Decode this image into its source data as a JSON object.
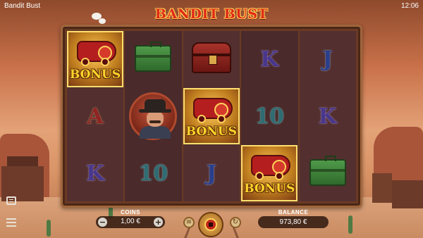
{
  "status_bar": {
    "app_title": "Bandit Bust",
    "clock": "12:06"
  },
  "logo": {
    "text": "BANDIT BUST"
  },
  "reels": [
    [
      {
        "type": "bonus",
        "label": "BONUS"
      },
      {
        "type": "card",
        "symbol": "A",
        "color": "red"
      },
      {
        "type": "card",
        "symbol": "K",
        "color": "purple"
      }
    ],
    [
      {
        "type": "case"
      },
      {
        "type": "bandit"
      },
      {
        "type": "card",
        "symbol": "10",
        "color": "teal"
      }
    ],
    [
      {
        "type": "chest"
      },
      {
        "type": "bonus",
        "label": "BONUS"
      },
      {
        "type": "card",
        "symbol": "J",
        "color": "blue"
      }
    ],
    [
      {
        "type": "card",
        "symbol": "K",
        "color": "purple"
      },
      {
        "type": "card",
        "symbol": "10",
        "color": "teal"
      },
      {
        "type": "bonus",
        "label": "BONUS"
      }
    ],
    [
      {
        "type": "card",
        "symbol": "J",
        "color": "blue"
      },
      {
        "type": "card",
        "symbol": "K",
        "color": "purple"
      },
      {
        "type": "case"
      }
    ]
  ],
  "controls": {
    "coins_label": "COINS",
    "coins_value": "1,00 €",
    "minus": "−",
    "plus": "+",
    "balance_label": "BALANCE",
    "balance_value": "973,80 €"
  },
  "icons": {
    "paytable": "paytable-icon",
    "menu": "menu-icon",
    "spin": "spin-icon",
    "autoplay": "autoplay-icon",
    "turbo": "turbo-icon"
  },
  "colors": {
    "logo_red": "#e02a17",
    "bonus_gold": "#ffd42a",
    "frame_brown": "#6b3a24"
  }
}
